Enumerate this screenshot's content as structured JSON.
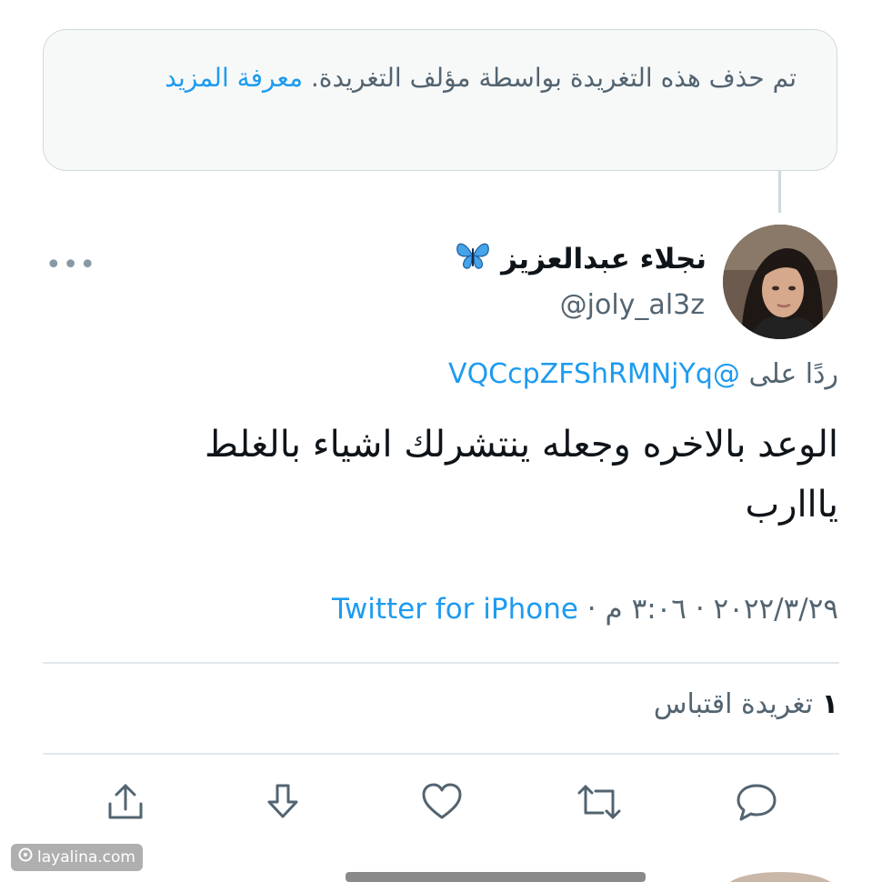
{
  "notice": {
    "text": "تم حذف هذه التغريدة بواسطة مؤلف التغريدة.",
    "link": "معرفة المزيد"
  },
  "author": {
    "name": "نجلاء عبدالعزيز",
    "badge_emoji": "🦋",
    "handle": "@joly_al3z"
  },
  "reply": {
    "prefix": "ردًا على",
    "mention": "@VQCcpZFShRMNjYq"
  },
  "tweet": {
    "text": "الوعد بالاخره وجعله ينتشرلك اشياء بالغلط يااارب"
  },
  "meta": {
    "date": "٢٠٢٢/٣/٢٩",
    "time": "٣:٠٦ م",
    "separator": "·",
    "source": "Twitter for iPhone"
  },
  "stats": {
    "quote_count": "١",
    "quote_label": "تغريدة اقتباس"
  },
  "actions": {
    "share_icon": "share-icon",
    "download_icon": "download-icon",
    "like_icon": "heart-icon",
    "retweet_icon": "retweet-icon",
    "reply_icon": "reply-icon"
  },
  "watermark": {
    "text": "layalina.com"
  },
  "colors": {
    "link": "#1d9bf0",
    "secondary_text": "#536471",
    "icon": "#536471",
    "notice_bg": "#f7f9f9",
    "border": "#cfd9de"
  }
}
